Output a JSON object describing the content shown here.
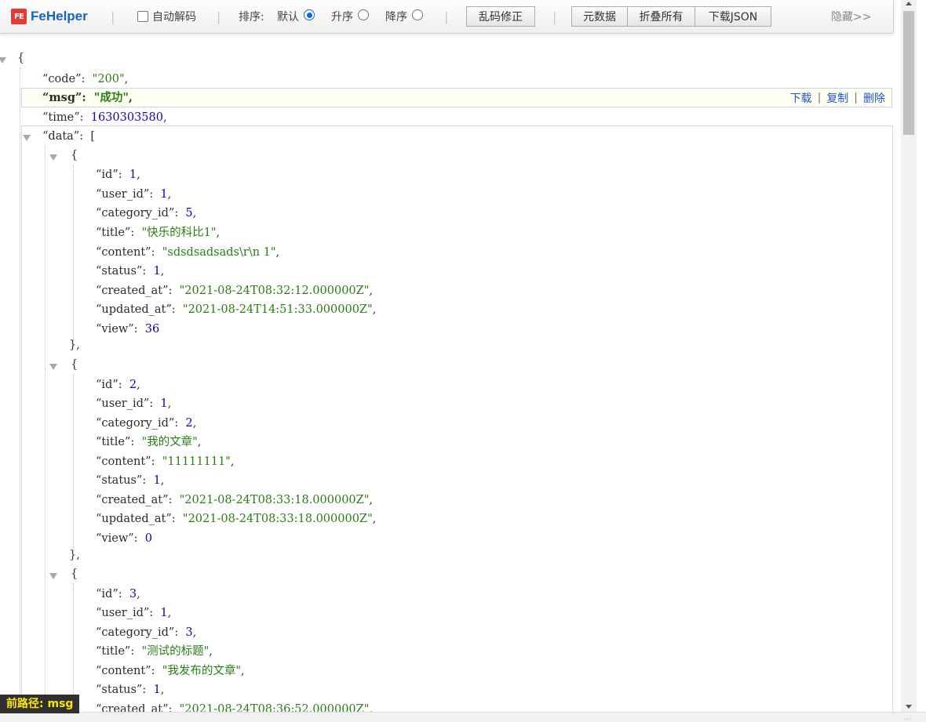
{
  "toolbar": {
    "logo_mark": "FE",
    "logo_text": "FeHelper",
    "auto_decode_label": "自动解码",
    "sort_label": "排序:",
    "sort_default": "默认",
    "sort_asc": "升序",
    "sort_desc": "降序",
    "fix_encoding": "乱码修正",
    "metadata": "元数据",
    "collapse_all": "折叠所有",
    "download_json": "下载JSON",
    "hide": "隐藏>>"
  },
  "row_actions": {
    "download": "下载",
    "copy": "复制",
    "delete": "删除"
  },
  "current_path": {
    "label": "前路径:",
    "value": "msg"
  },
  "watermark": "...",
  "json": {
    "code": "\"200\"",
    "msg": "\"成功\"",
    "time": "1630303580",
    "data": [
      {
        "id": "1",
        "user_id": "1",
        "category_id": "5",
        "title": "\"快乐的科比1\"",
        "content": "\"sdsdsadsads\\r\\n 1\"",
        "status": "1",
        "created_at": "\"2021-08-24T08:32:12.000000Z\"",
        "updated_at": "\"2021-08-24T14:51:33.000000Z\"",
        "view": "36"
      },
      {
        "id": "2",
        "user_id": "1",
        "category_id": "2",
        "title": "\"我的文章\"",
        "content": "\"11111111\"",
        "status": "1",
        "created_at": "\"2021-08-24T08:33:18.000000Z\"",
        "updated_at": "\"2021-08-24T08:33:18.000000Z\"",
        "view": "0"
      },
      {
        "id": "3",
        "user_id": "1",
        "category_id": "3",
        "title": "\"测试的标题\"",
        "content": "\"我发布的文章\"",
        "status": "1",
        "created_at": "\"2021-08-24T08:36:52.000000Z\""
      }
    ]
  }
}
